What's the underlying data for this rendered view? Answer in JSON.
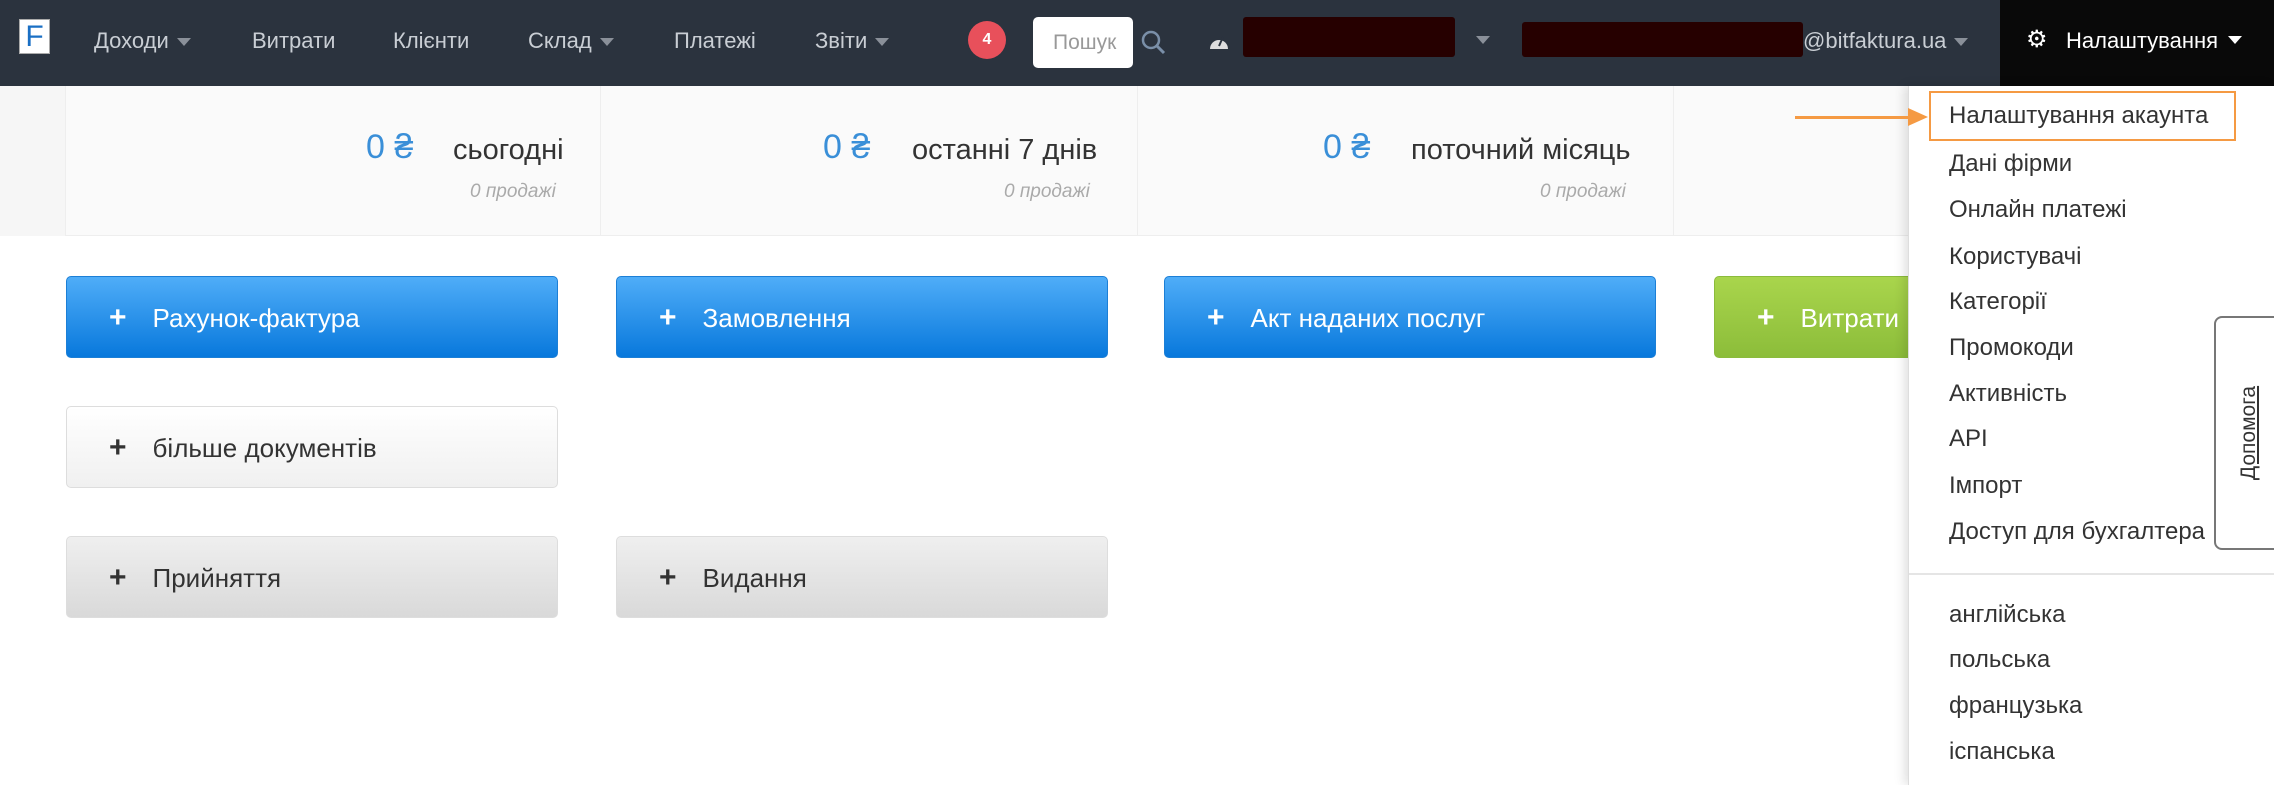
{
  "nav": {
    "logo": "F",
    "items": [
      {
        "label": "Доходи",
        "caret": true
      },
      {
        "label": "Витрати"
      },
      {
        "label": "Клієнти"
      },
      {
        "label": "Склад",
        "caret": true
      },
      {
        "label": "Платежі"
      },
      {
        "label": "Звіти",
        "caret": true
      }
    ],
    "badge": "4",
    "search_placeholder": "Пошук",
    "user_email_suffix": "@bitfaktura.ua",
    "settings_label": "Налаштування"
  },
  "stats": [
    {
      "value": "0 ₴",
      "label": "сьогодні",
      "sub": "0 продажі"
    },
    {
      "value": "0 ₴",
      "label": "останні 7 днів",
      "sub": "0 продажі"
    },
    {
      "value": "0 ₴",
      "label": "поточний місяць",
      "sub": "0 продажі"
    }
  ],
  "buttons": {
    "invoice": "Рахунок-фактура",
    "order": "Замовлення",
    "act": "Акт наданих послуг",
    "expenses": "Витрати",
    "more_docs": "більше документів",
    "receipt": "Прийняття",
    "issue": "Видання"
  },
  "settings_menu": {
    "items": [
      "Налаштування акаунта",
      "Дані фірми",
      "Онлайн платежі",
      "Користувачі",
      "Категорії",
      "Промокоди",
      "Активність",
      "API",
      "Імпорт",
      "Доступ для бухгалтера"
    ],
    "languages": [
      "англійська",
      "польська",
      "французька",
      "іспанська"
    ],
    "highlighted": "Налаштування акаунта"
  },
  "help_tab": "Допомога",
  "colors": {
    "navbar": "#2b333e",
    "accent_blue": "#0878dc",
    "highlight": "#f59a43",
    "badge": "#e8505b"
  }
}
